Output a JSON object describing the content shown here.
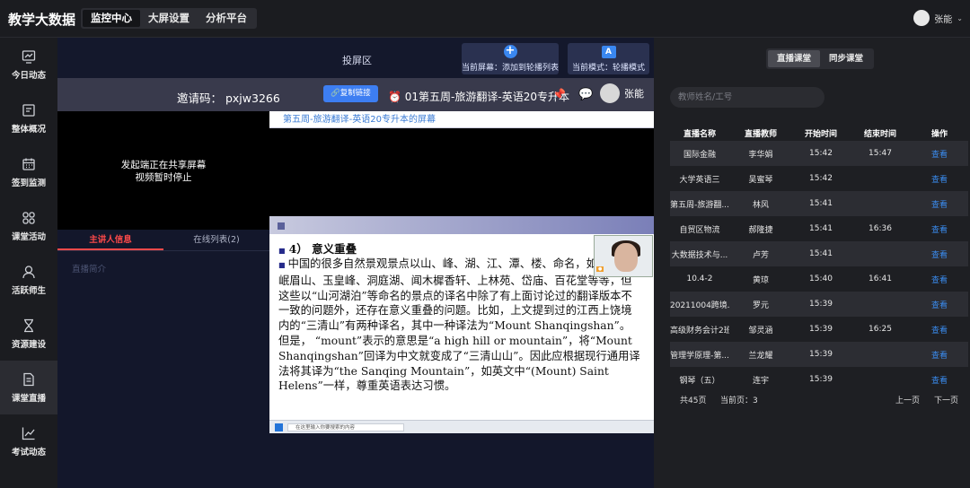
{
  "topbar": {
    "brand": "教学大数据",
    "nav": [
      "监控中心",
      "大屏设置",
      "分析平台"
    ],
    "user_name": "张能"
  },
  "sidebar": {
    "items": [
      {
        "label": "今日动态",
        "icon": "monitor-chart-icon"
      },
      {
        "label": "整体概况",
        "icon": "overview-icon"
      },
      {
        "label": "签到监测",
        "icon": "calendar-icon"
      },
      {
        "label": "课堂活动",
        "icon": "grid-icon"
      },
      {
        "label": "活跃师生",
        "icon": "user-icon"
      },
      {
        "label": "资源建设",
        "icon": "hourglass-icon"
      },
      {
        "label": "课堂直播",
        "icon": "document-icon"
      },
      {
        "label": "考试动态",
        "icon": "line-chart-icon"
      }
    ],
    "active": "课堂直播"
  },
  "cast": {
    "label": "投屏区",
    "add_button": "当前屏幕：添加到轮播列表",
    "mode_button": "当前模式：轮播模式"
  },
  "meeting": {
    "invite": "邀请码：  pxjw3266",
    "copy_button": "复制链接",
    "title": "01第五周-旅游翻译-英语20专升本",
    "host_name": "张能"
  },
  "stream": {
    "stopped_line1": "发起端正在共享屏幕",
    "stopped_line2": "视频暂时停止",
    "share_title": "第五周-旅游翻译-英语20专升本的屏幕"
  },
  "info_tabs": {
    "host_info": "主讲人信息",
    "online_list": "在线列表(2)",
    "intro": "直播简介"
  },
  "slide": {
    "heading": "4） 意义重叠",
    "paragraph": "中国的很多自然景观景点以山、峰、湖、江、潭、楼、命名，如泰山、岷眉山、玉皇峰、洞庭湖、闻木樨香轩、上林苑、岱庙、百花堂等等，但这些以“山河湖泊”等命名的景点的译名中除了有上面讨论过的翻译版本不一致的问题外，还存在意义重叠的问题。比如，上文提到过的江西上饶境内的“三清山”有两种译名，其中一种译法为“Mount Shanqingshan”。但是， “mount”表示的意思是“a high hill or mountain”，将“Mount Shanqingshan”回译为中文就变成了“三清山山”。因此应根据现行通用译法将其译为“the Sanqing Mountain”，如英文中“(Mount) Saint Helens”一样，尊重英语表达习惯。",
    "taskbar_search": "在这里输入你要搜索的内容"
  },
  "right": {
    "tabs": [
      "直播课堂",
      "同步课堂"
    ],
    "search_placeholder": "教师姓名/工号",
    "columns": [
      "直播名称",
      "直播教师",
      "开始时间",
      "结束时间",
      "操作"
    ],
    "rows": [
      [
        "国际金融",
        "李华娟",
        "15:42",
        "15:47",
        "查看"
      ],
      [
        "大学英语三",
        "吴蜜琴",
        "15:42",
        "",
        "查看"
      ],
      [
        "第五周-旅游翻...",
        "林风",
        "15:41",
        "",
        "查看"
      ],
      [
        "自贸区物流",
        "郝隆捷",
        "15:41",
        "16:36",
        "查看"
      ],
      [
        "大数据技术与...",
        "卢芳",
        "15:41",
        "",
        "查看"
      ],
      [
        "10.4-2",
        "黄琼",
        "15:40",
        "16:41",
        "查看"
      ],
      [
        "20211004跨境...",
        "罗元",
        "15:39",
        "",
        "查看"
      ],
      [
        "高级财务会计2班",
        "邹灵涵",
        "15:39",
        "16:25",
        "查看"
      ],
      [
        "管理学原理-第...",
        "兰龙耀",
        "15:39",
        "",
        "查看"
      ],
      [
        "钢琴（五）",
        "连宇",
        "15:39",
        "",
        "查看"
      ]
    ],
    "total": "共45页",
    "current": "当前页：3",
    "prev": "上一页",
    "next": "下一页"
  },
  "colors": {
    "accent_blue": "#3d7ef2",
    "active_tab_red": "#ff4a4a",
    "link_blue": "#3a8cf0"
  }
}
